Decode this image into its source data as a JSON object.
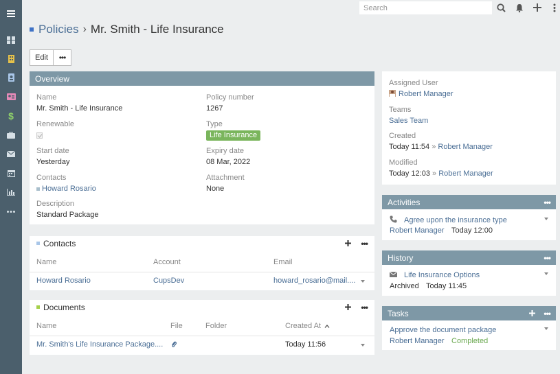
{
  "search": {
    "placeholder": "Search"
  },
  "sidebar": {
    "items": [
      {
        "name": "menu-icon",
        "color": "#ffffff"
      },
      {
        "name": "dashboard-icon",
        "color": "#d7e0e6"
      },
      {
        "name": "building-icon",
        "color": "#e5c14a"
      },
      {
        "name": "contact-card-icon",
        "color": "#a9c6e8"
      },
      {
        "name": "id-card-icon",
        "color": "#e58ab8"
      },
      {
        "name": "dollar-icon",
        "color": "#8fd06a"
      },
      {
        "name": "briefcase-icon",
        "color": "#d7e0e6"
      },
      {
        "name": "envelope-icon",
        "color": "#d7e0e6"
      },
      {
        "name": "calendar-icon",
        "color": "#d7e0e6"
      },
      {
        "name": "bar-chart-icon",
        "color": "#d7e0e6"
      },
      {
        "name": "more-icon",
        "color": "#d7e0e6"
      }
    ]
  },
  "header": {
    "breadcrumb": "Policies",
    "separator": "›",
    "title": "Mr. Smith - Life Insurance"
  },
  "actions": {
    "edit_label": "Edit",
    "more_label": "•••"
  },
  "overview": {
    "title": "Overview",
    "name_label": "Name",
    "name_value": "Mr. Smith - Life Insurance",
    "policy_label": "Policy number",
    "policy_value": "1267",
    "renewable_label": "Renewable",
    "type_label": "Type",
    "type_value": "Life Insurance",
    "start_label": "Start date",
    "start_value": "Yesterday",
    "expiry_label": "Expiry date",
    "expiry_value": "08 Mar, 2022",
    "contacts_label": "Contacts",
    "contacts_value": "Howard Rosario",
    "attachment_label": "Attachment",
    "attachment_value": "None",
    "description_label": "Description",
    "description_value": "Standard Package"
  },
  "contacts": {
    "title": "Contacts",
    "columns": [
      "Name",
      "Account",
      "Email"
    ],
    "rows": [
      {
        "name": "Howard Rosario",
        "account": "CupsDev",
        "email": "howard_rosario@mail...."
      }
    ]
  },
  "documents": {
    "title": "Documents",
    "columns": [
      "Name",
      "File",
      "Folder",
      "Created At"
    ],
    "rows": [
      {
        "name": "Mr. Smith's Life Insurance Package....",
        "created": "Today 11:56"
      }
    ]
  },
  "side": {
    "assigned_label": "Assigned User",
    "assigned_value": "Robert Manager",
    "teams_label": "Teams",
    "teams_value": "Sales Team",
    "created_label": "Created",
    "created_time": "Today 11:54",
    "created_by": "Robert Manager",
    "modified_label": "Modified",
    "modified_time": "Today 12:03",
    "modified_by": "Robert Manager",
    "arrow": "»"
  },
  "activities": {
    "title": "Activities",
    "item": "Agree upon the insurance type",
    "user": "Robert Manager",
    "time": "Today 12:00"
  },
  "history": {
    "title": "History",
    "item": "Life Insurance Options",
    "status": "Archived",
    "time": "Today 11:45"
  },
  "tasks": {
    "title": "Tasks",
    "item": "Approve the document package",
    "user": "Robert Manager",
    "status": "Completed"
  },
  "colors": {
    "sidebar": "#4b5f6c",
    "panel_header": "#7e98a6",
    "link": "#4a6e95",
    "badge": "#7ab55c",
    "accent": "#3f72c6",
    "documents_marker": "#a5d04a",
    "contacts_marker": "#a9c6e8"
  }
}
